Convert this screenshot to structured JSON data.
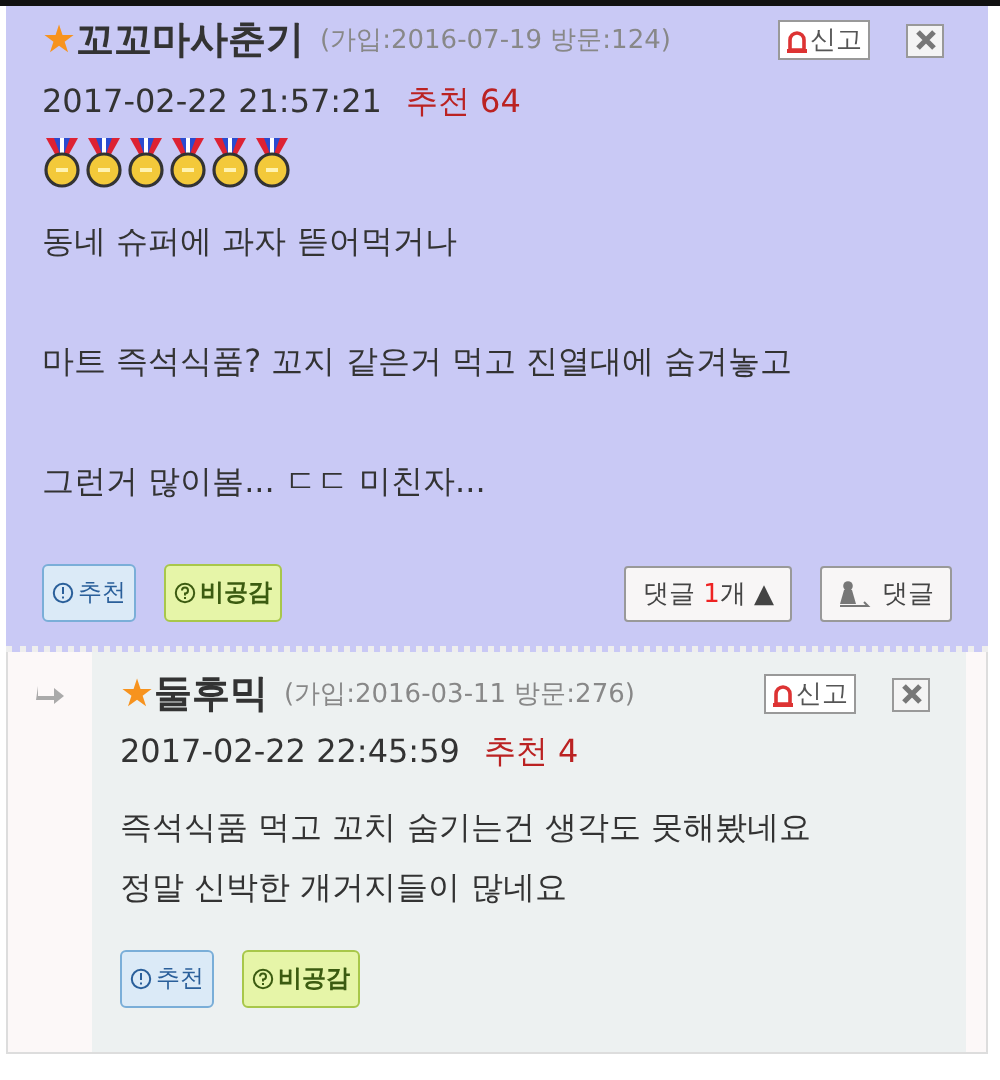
{
  "posts": [
    {
      "kind": "main",
      "star": "★",
      "name": "꼬꼬마사춘기",
      "info": "(가입:2016-07-19 방문:124)",
      "report": "신고",
      "date": "2017-02-22 21:57:21",
      "recommend": "추천 64",
      "medals": [
        {
          "kind": "gold"
        },
        {
          "kind": "gold"
        },
        {
          "kind": "gold"
        },
        {
          "kind": "gold"
        },
        {
          "kind": "gold"
        },
        {
          "kind": "gold"
        }
      ],
      "paragraphs": [
        [
          "동네 슈퍼에 과자 뜯어먹거나"
        ],
        [
          "마트 즉석식품? 꼬지 같은거 먹고 진열대에 숨겨놓고"
        ],
        [
          "그런거 많이봄... ㄷㄷ 미친자..."
        ]
      ],
      "like": "추천",
      "dislike": "비공감",
      "reply_count": {
        "prefix": "댓글 ",
        "count": "1",
        "suffix": "개 ",
        "arrow": "▲"
      },
      "reply": "댓글"
    },
    {
      "kind": "reply",
      "star": "★",
      "name": "둘후믹",
      "info": "(가입:2016-03-11 방문:276)",
      "report": "신고",
      "date": "2017-02-22 22:45:59",
      "recommend": "추천 4",
      "paragraphs": [
        [
          "즉석식품 먹고 꼬치 숨기는건 생각도 못해봤네요",
          "정말 신박한 개거지들이 많네요"
        ]
      ],
      "like": "추천",
      "dislike": "비공감"
    }
  ]
}
